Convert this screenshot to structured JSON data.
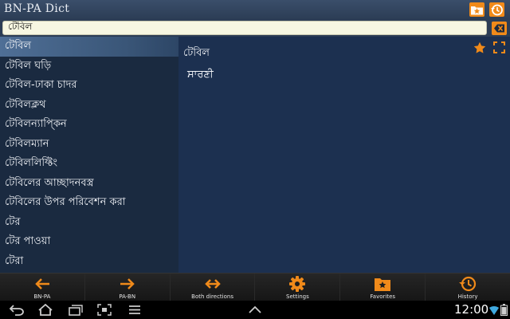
{
  "app": {
    "title": "BN-PA Dict"
  },
  "search": {
    "value": "টেবিল"
  },
  "words": [
    "টেবিল",
    "টেবিল ঘড়ি",
    "টেবিল-ঢাকা চাদর",
    "টেবিলক্লথ",
    "টেবিলন্যাপ্কিন",
    "টেবিলম্যান",
    "টেবিললিফ্টিং",
    "টেবিলের আচ্ছাদনবস্ত্র",
    "টেবিলের উপর পরিবেশন করা",
    "টের",
    "টের পাওয়া",
    "টেরা"
  ],
  "definition": {
    "headword": "টেবিল",
    "translation": "ਸਾਰਣੀ"
  },
  "toolbar": [
    {
      "label": "BN-PA",
      "icon": "arrow-left-icon"
    },
    {
      "label": "PA-BN",
      "icon": "arrow-right-icon"
    },
    {
      "label": "Both directions",
      "icon": "arrows-both-icon"
    },
    {
      "label": "Settings",
      "icon": "gear-icon"
    },
    {
      "label": "Favorites",
      "icon": "favorites-folder-icon"
    },
    {
      "label": "History",
      "icon": "history-icon"
    }
  ],
  "status": {
    "time": "12:00"
  },
  "colors": {
    "accent": "#f08a1a",
    "list_bg": "#1a2a40",
    "pane_bg": "#1c3050",
    "selected": "#4f6f96"
  }
}
